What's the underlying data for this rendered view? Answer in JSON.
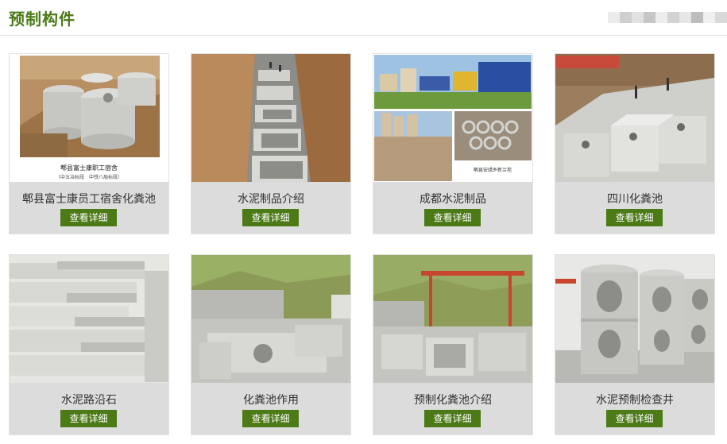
{
  "section": {
    "title": "预制构件"
  },
  "header_strip_colors": [
    "#ececec",
    "#cfcfcf",
    "#e2e2e2",
    "#c6c6c6",
    "#ededed",
    "#d2d2d2",
    "#e6e6e6",
    "#bdbdbd",
    "#f0f0f0",
    "#d9d9d9"
  ],
  "products": [
    {
      "name": "郫县富士康员工宿舍化粪池",
      "button": "查看详细",
      "photo_caption": "郫县富士康职工宿舍",
      "photo_subcaption": "（中五冶标段　中铁八局标段）"
    },
    {
      "name": "水泥制品介绍",
      "button": "查看详细"
    },
    {
      "name": "成都水泥制品",
      "button": "查看详细",
      "photo_caption": "郫县安靖乡新兰苑"
    },
    {
      "name": "四川化粪池",
      "button": "查看详细"
    },
    {
      "name": "水泥路沿石",
      "button": "查看详细"
    },
    {
      "name": "化粪池作用",
      "button": "查看详细"
    },
    {
      "name": "预制化粪池介绍",
      "button": "查看详细"
    },
    {
      "name": "水泥预制检查井",
      "button": "查看详细"
    }
  ],
  "theme": {
    "accent": "#4b7a16",
    "card_bg": "#dcdcdc",
    "text": "#333333"
  }
}
